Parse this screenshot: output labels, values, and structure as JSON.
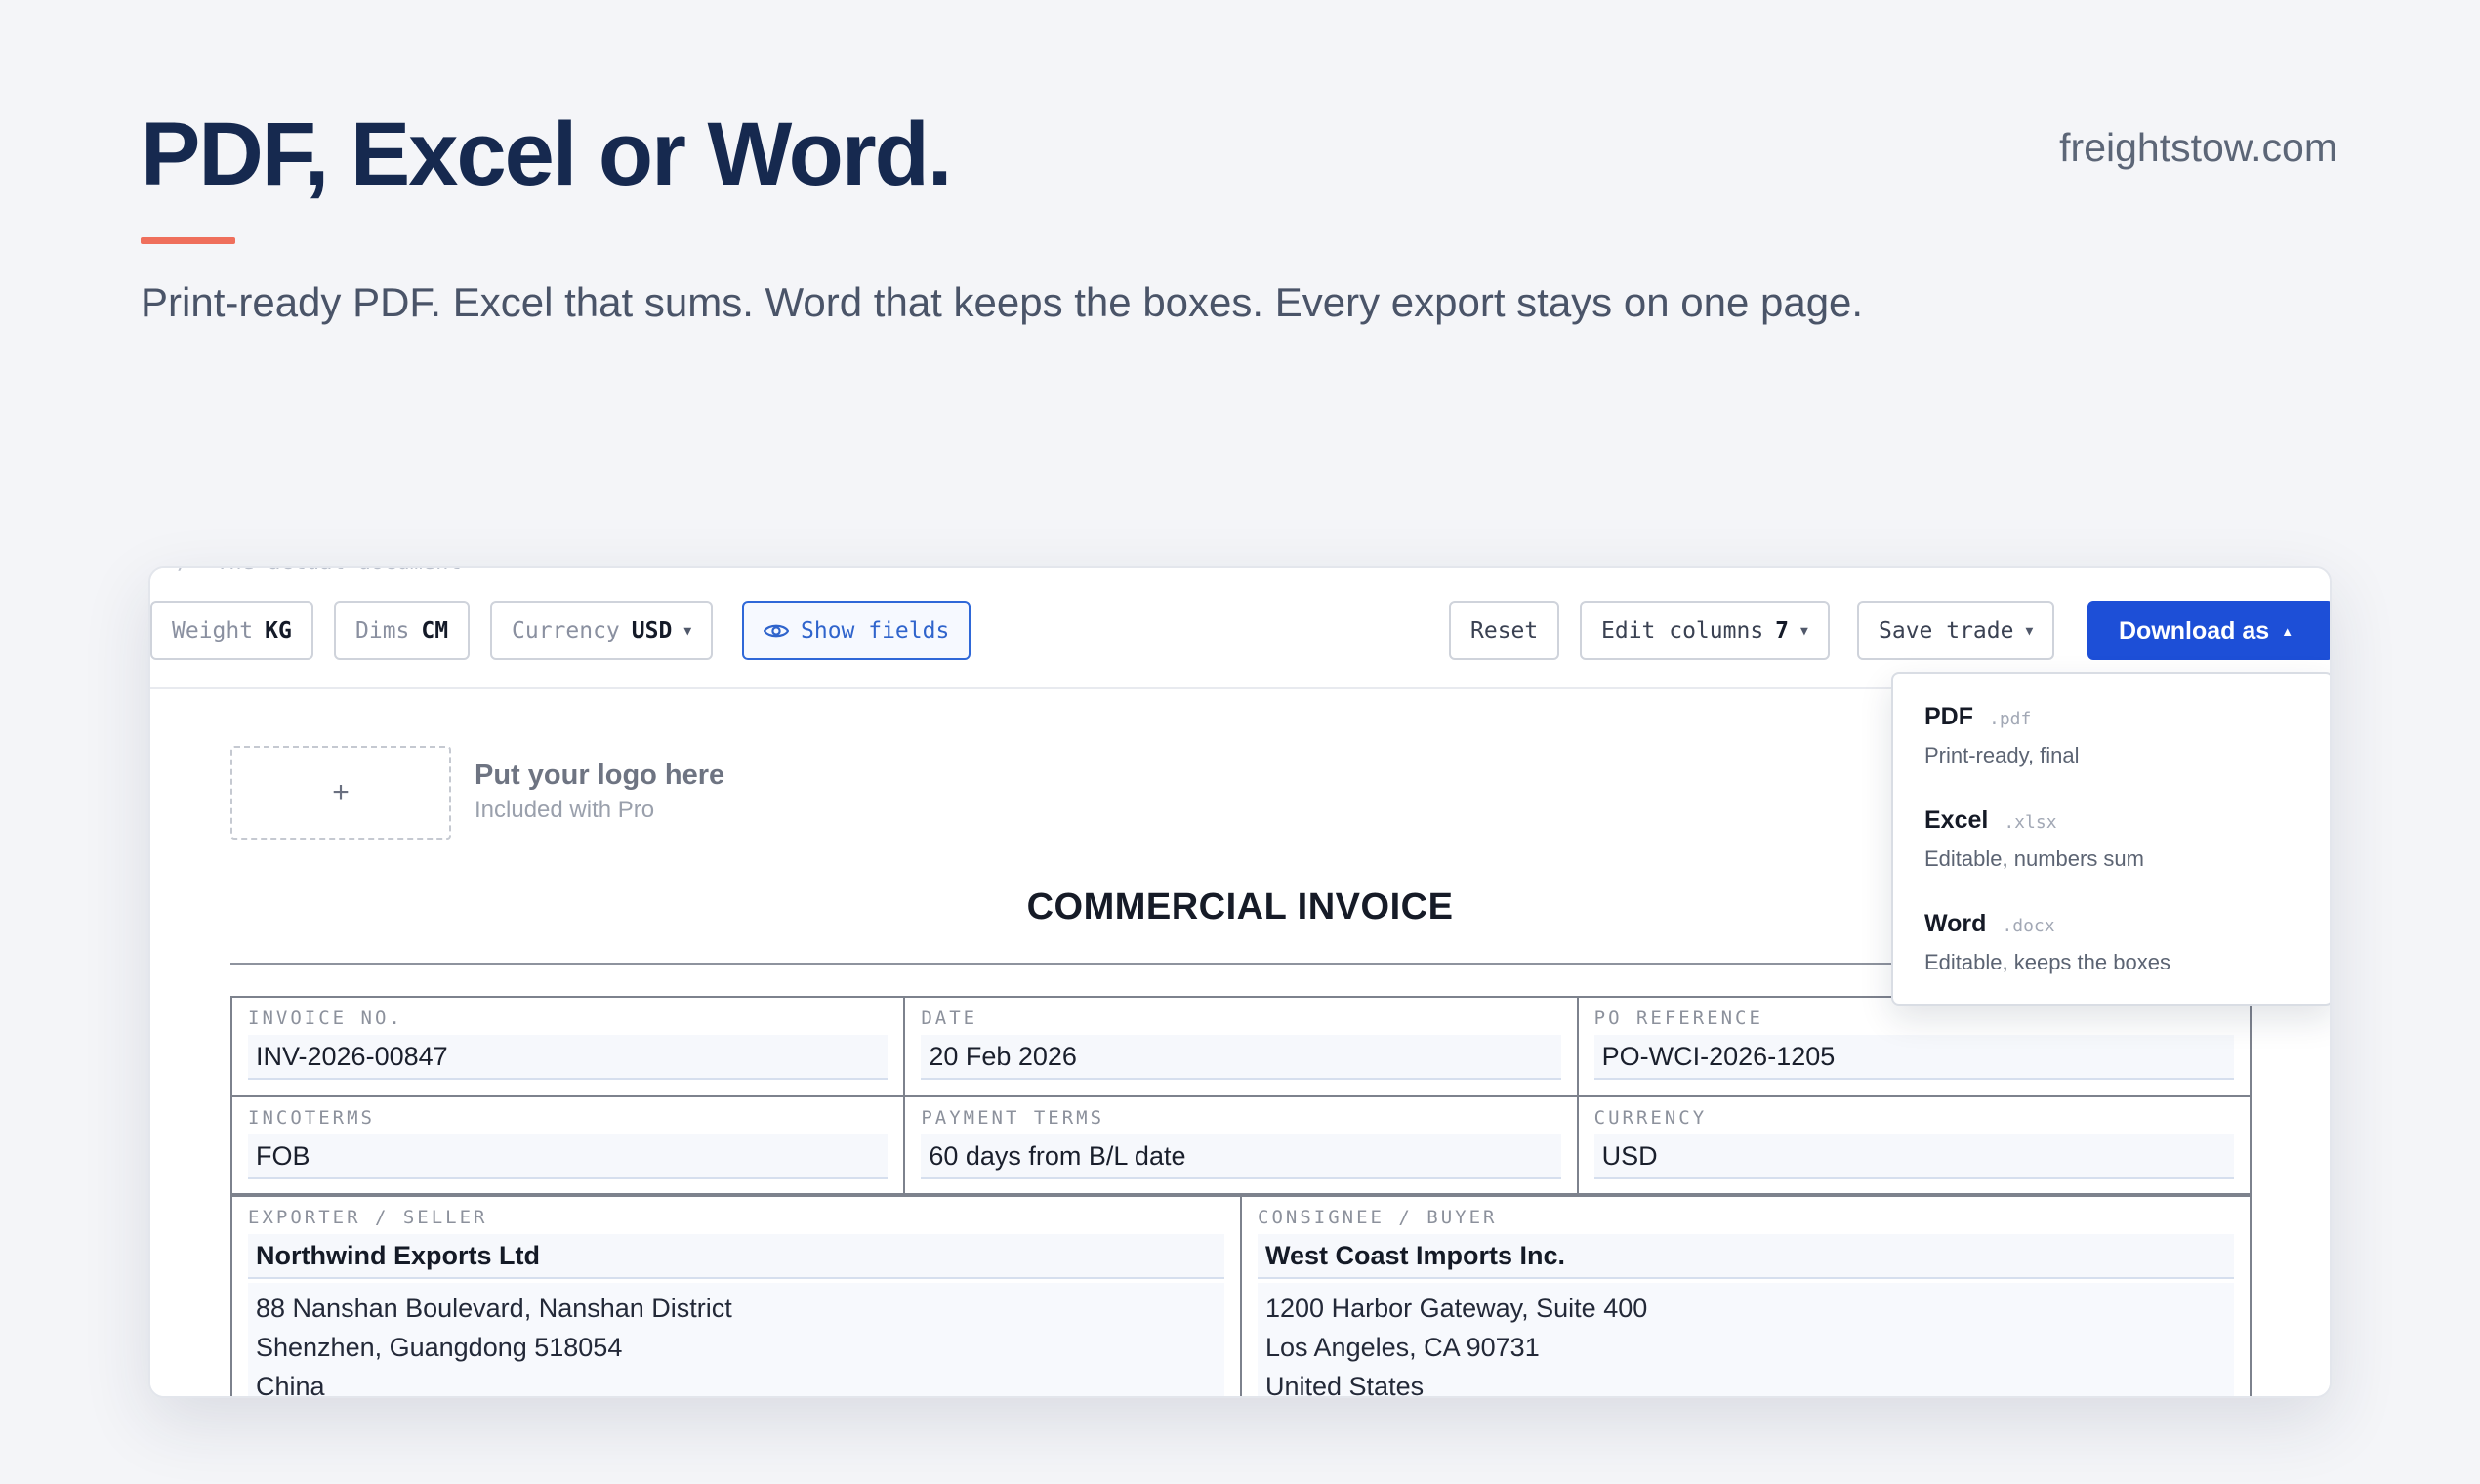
{
  "hero": {
    "title": "PDF, Excel or Word.",
    "domain": "freightstow.com",
    "subtitle": "Print-ready PDF. Excel that sums. Word that keeps the boxes. Every export stays on one page."
  },
  "toolbar": {
    "cut_text": "‹/› The actual document",
    "weight": {
      "label": "Weight",
      "value": "KG"
    },
    "dims": {
      "label": "Dims",
      "value": "CM"
    },
    "currency": {
      "label": "Currency",
      "value": "USD"
    },
    "show_fields": "Show fields",
    "reset": "Reset",
    "edit_columns": {
      "label": "Edit columns",
      "count": "7"
    },
    "save_trade": "Save trade",
    "download": "Download as"
  },
  "download_menu": {
    "items": [
      {
        "label": "PDF",
        "ext": ".pdf",
        "desc": "Print-ready, final"
      },
      {
        "label": "Excel",
        "ext": ".xlsx",
        "desc": "Editable, numbers sum"
      },
      {
        "label": "Word",
        "ext": ".docx",
        "desc": "Editable, keeps the boxes"
      }
    ]
  },
  "document": {
    "logo_plus": "+",
    "logo_title": "Put your logo here",
    "logo_sub": "Included with Pro",
    "title": "COMMERCIAL INVOICE",
    "fields": {
      "invoice_no": {
        "label": "INVOICE NO.",
        "value": "INV-2026-00847"
      },
      "date": {
        "label": "DATE",
        "value": "20 Feb 2026"
      },
      "po_reference": {
        "label": "PO REFERENCE",
        "value": "PO-WCI-2026-1205"
      },
      "incoterms": {
        "label": "INCOTERMS",
        "value": "FOB"
      },
      "payment_terms": {
        "label": "PAYMENT TERMS",
        "value": "60 days from B/L date"
      },
      "currency": {
        "label": "CURRENCY",
        "value": "USD"
      }
    },
    "exporter": {
      "label": "EXPORTER / SELLER",
      "name": "Northwind Exports Ltd",
      "address": [
        "88 Nanshan Boulevard, Nanshan District",
        "Shenzhen, Guangdong 518054",
        "China"
      ]
    },
    "consignee": {
      "label": "CONSIGNEE / BUYER",
      "name": "West Coast Imports Inc.",
      "address": [
        "1200 Harbor Gateway, Suite 400",
        "Los Angeles, CA 90731",
        "United States"
      ]
    }
  },
  "colors": {
    "primary": "#1d4fd7",
    "accent": "#ef6f5c",
    "title": "#16294f"
  }
}
